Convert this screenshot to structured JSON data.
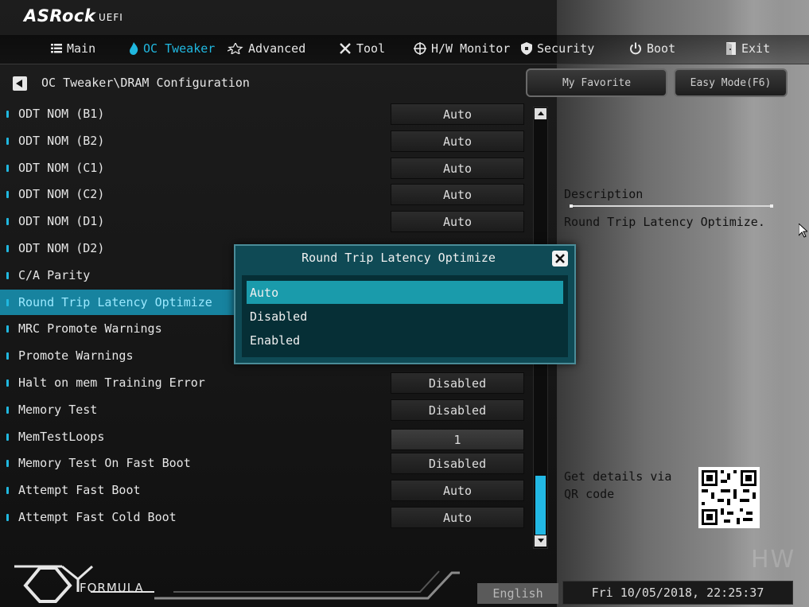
{
  "brand": {
    "name": "ASRock",
    "suffix": "UEFI"
  },
  "menu": {
    "tabs": [
      {
        "label": "Main",
        "icon": "list-icon"
      },
      {
        "label": "OC Tweaker",
        "icon": "flame-icon",
        "active": true
      },
      {
        "label": "Advanced",
        "icon": "star-icon"
      },
      {
        "label": "Tool",
        "icon": "wrench-icon"
      },
      {
        "label": "H/W Monitor",
        "icon": "crosshair-icon"
      },
      {
        "label": "Security",
        "icon": "shield-icon"
      },
      {
        "label": "Boot",
        "icon": "power-icon"
      },
      {
        "label": "Exit",
        "icon": "exit-icon"
      }
    ]
  },
  "breadcrumb": "OC Tweaker\\DRAM Configuration",
  "buttons": {
    "favorite": "My Favorite",
    "easy_mode": "Easy Mode(F6)"
  },
  "settings": [
    {
      "label": "ODT NOM (B1)",
      "value": "Auto"
    },
    {
      "label": "ODT NOM (B2)",
      "value": "Auto"
    },
    {
      "label": "ODT NOM (C1)",
      "value": "Auto"
    },
    {
      "label": "ODT NOM (C2)",
      "value": "Auto"
    },
    {
      "label": "ODT NOM (D1)",
      "value": "Auto"
    },
    {
      "label": "ODT NOM (D2)",
      "value": ""
    },
    {
      "label": "C/A Parity",
      "value": ""
    },
    {
      "label": "Round Trip Latency Optimize",
      "value": "",
      "selected": true
    },
    {
      "label": "MRC Promote Warnings",
      "value": ""
    },
    {
      "label": "Promote Warnings",
      "value": ""
    },
    {
      "label": "Halt on mem Training Error",
      "value": "Disabled"
    },
    {
      "label": "Memory Test",
      "value": "Disabled"
    },
    {
      "label": "MemTestLoops",
      "value": "1",
      "input": true
    },
    {
      "label": "Memory Test On Fast Boot",
      "value": "Disabled"
    },
    {
      "label": "Attempt Fast Boot",
      "value": "Auto"
    },
    {
      "label": "Attempt Fast Cold Boot",
      "value": "Auto"
    }
  ],
  "description": {
    "title": "Description",
    "text": "Round Trip Latency Optimize."
  },
  "qr": {
    "text": "Get details via QR code"
  },
  "footer": {
    "logo_text": "FORMULA",
    "language": "English",
    "datetime": "Fri 10/05/2018, 22:25:37"
  },
  "dialog": {
    "title": "Round Trip Latency Optimize",
    "options": [
      "Auto",
      "Disabled",
      "Enabled"
    ],
    "selected_index": 0
  },
  "watermark": "HW",
  "colors": {
    "accent": "#20b8e0",
    "dialog_bg": "#0f4a55",
    "dialog_sel": "#1a9bab"
  }
}
